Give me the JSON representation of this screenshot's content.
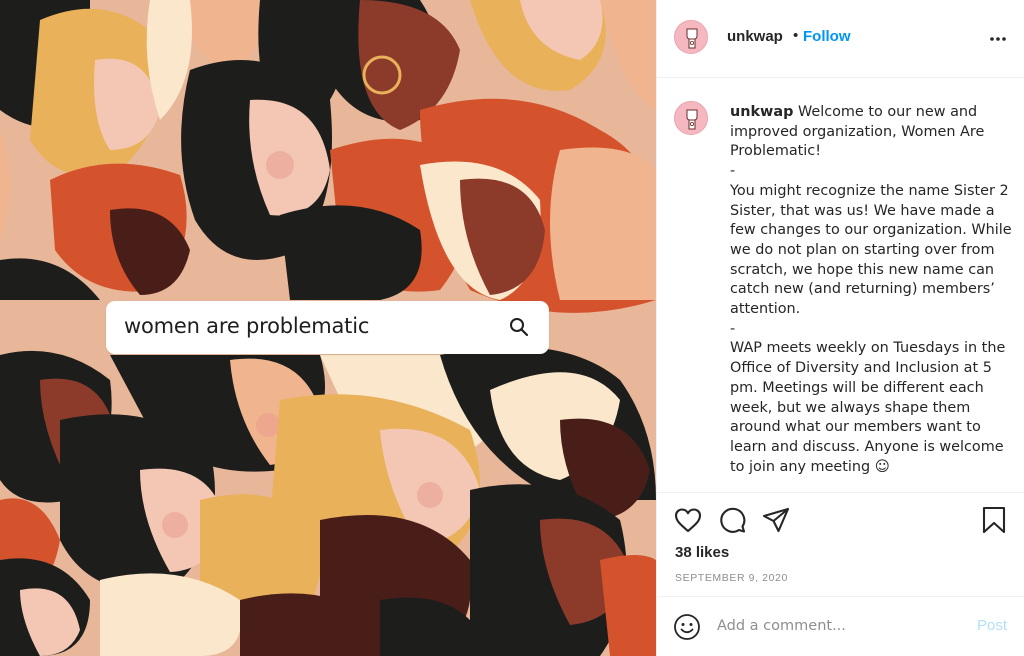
{
  "image": {
    "search_text": "women are problematic",
    "colors": {
      "background": "#e8b79a",
      "dark_hair": "#1d1d1b",
      "red_orange": "#d4532c",
      "skin_light": "#f3c7b3",
      "skin_peach": "#f0b48f",
      "skin_brown": "#8c3b2b",
      "skin_dark": "#4a1e18",
      "blonde": "#e9b15a",
      "cream": "#fbe8cc"
    }
  },
  "post": {
    "username": "unkwap",
    "separator": "•",
    "follow_label": "Follow",
    "more_icon": "more-options-icon",
    "caption": {
      "username": "unkwap",
      "lines": [
        "Welcome to our new and improved organization, Women Are Problematic!",
        "-",
        "You might recognize the name Sister 2 Sister, that was us! We have made a few changes to our organization. While we do not plan on starting over from scratch, we hope this new name can catch new (and returning) members’ attention.",
        "-",
        "WAP meets weekly on Tuesdays in the Office of Diversity and Inclusion at 5 pm. Meetings will be different each week, but we always shape them around what our members want to learn and discuss. Anyone is welcome to join any meeting ☺"
      ]
    },
    "likes": "38 likes",
    "date": "SEPTEMBER 9, 2020",
    "comment": {
      "placeholder": "Add a comment...",
      "value": "",
      "post_label": "Post"
    },
    "accent_color": "#0095f6",
    "avatar_color": "#f5b8c0"
  }
}
